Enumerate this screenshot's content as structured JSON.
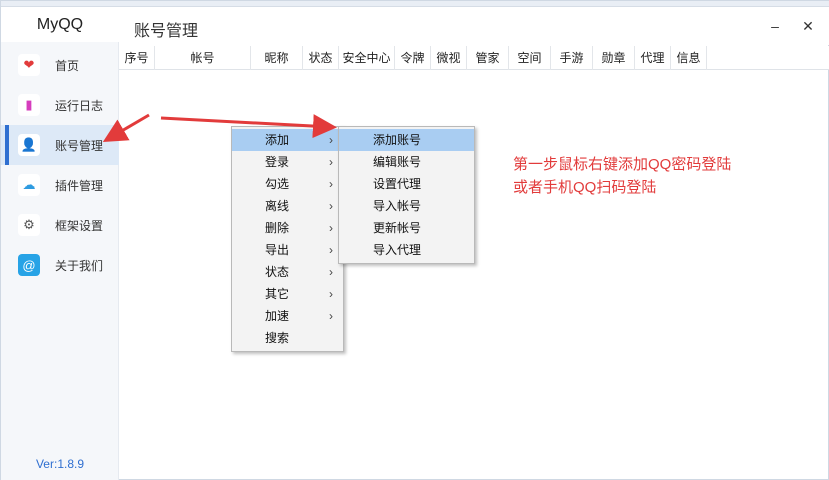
{
  "app": {
    "brand": "MyQQ",
    "version": "Ver:1.8.9"
  },
  "header": {
    "title": "账号管理",
    "minimize_glyph": "–",
    "close_glyph": "✕"
  },
  "sidebar": {
    "items": [
      {
        "label": "首页",
        "icon": "heart-icon",
        "glyph": "❤",
        "color": "#e23b3b",
        "bg": "#ffffff"
      },
      {
        "label": "运行日志",
        "icon": "bookmark-icon",
        "glyph": "▮",
        "color": "#d63dbd",
        "bg": "#ffffff"
      },
      {
        "label": "账号管理",
        "icon": "user-icon",
        "glyph": "👤",
        "color": "#333333",
        "bg": "#ffffff",
        "active": true
      },
      {
        "label": "插件管理",
        "icon": "cloud-icon",
        "glyph": "☁",
        "color": "#2e9be0",
        "bg": "#ffffff"
      },
      {
        "label": "框架设置",
        "icon": "gear-icon",
        "glyph": "⚙",
        "color": "#555555",
        "bg": "#ffffff"
      },
      {
        "label": "关于我们",
        "icon": "at-icon",
        "glyph": "@",
        "color": "#ffffff",
        "bg": "#27a3e6"
      }
    ]
  },
  "table": {
    "columns": [
      "序号",
      "帐号",
      "昵称",
      "状态",
      "安全中心",
      "令牌",
      "微视",
      "管家",
      "空间",
      "手游",
      "勋章",
      "代理",
      "信息"
    ]
  },
  "context_menu": {
    "items": [
      {
        "label": "添加",
        "submenu": true,
        "highlighted": true
      },
      {
        "label": "登录",
        "submenu": true
      },
      {
        "label": "勾选",
        "submenu": true
      },
      {
        "label": "离线",
        "submenu": true
      },
      {
        "label": "删除",
        "submenu": true
      },
      {
        "label": "导出",
        "submenu": true
      },
      {
        "label": "状态",
        "submenu": true
      },
      {
        "label": "其它",
        "submenu": true
      },
      {
        "label": "加速",
        "submenu": true
      },
      {
        "label": "搜索",
        "submenu": false
      }
    ],
    "arrow_glyph": "›"
  },
  "submenu": {
    "items": [
      {
        "label": "添加账号",
        "highlighted": true
      },
      {
        "label": "编辑账号"
      },
      {
        "label": "设置代理"
      },
      {
        "label": "导入帐号"
      },
      {
        "label": "更新帐号"
      },
      {
        "label": "导入代理"
      }
    ]
  },
  "annotation": {
    "line1": "第一步鼠标右键添加QQ密码登陆",
    "line2": "或者手机QQ扫码登陆",
    "color": "#e23b3b"
  }
}
